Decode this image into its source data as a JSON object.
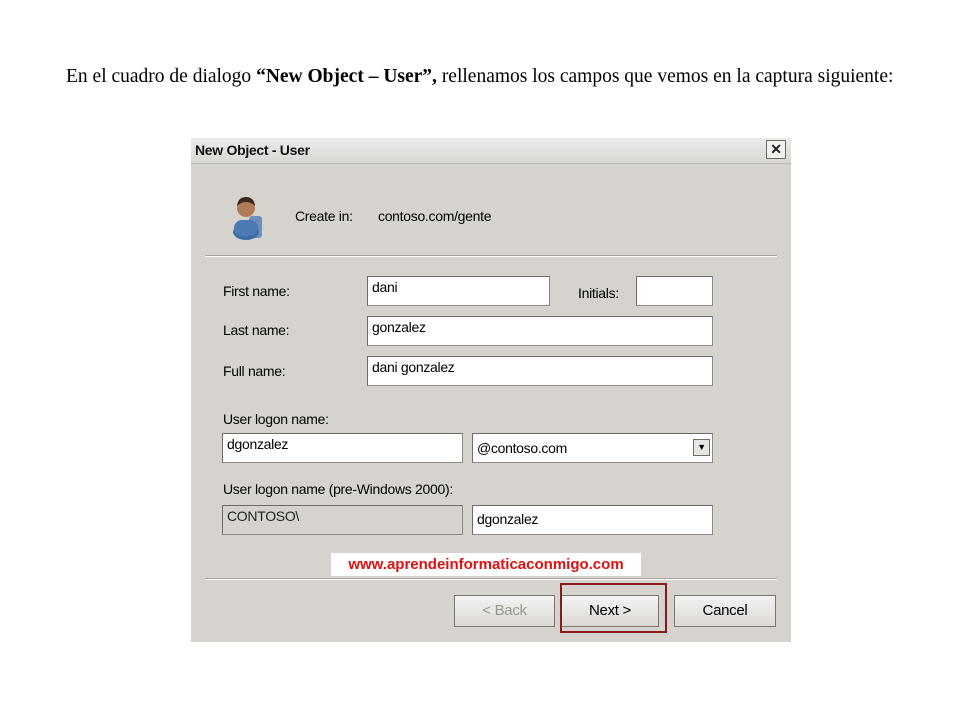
{
  "caption": {
    "before": "En el cuadro de dialogo ",
    "bold": "“New Object – User”,",
    "after": " rellenamos los campos que vemos en la captura siguiente:"
  },
  "dialog": {
    "title": "New Object - User",
    "close_glyph": "✕",
    "create_in_label": "Create in:",
    "create_in_value": "contoso.com/gente",
    "first_name_label": "First name:",
    "first_name_value": "dani",
    "initials_label": "Initials:",
    "initials_value": "",
    "last_name_label": "Last name:",
    "last_name_value": "gonzalez",
    "full_name_label": "Full name:",
    "full_name_value": "dani gonzalez",
    "logon_label": "User logon name:",
    "logon_value": "dgonzalez",
    "domain_value": "@contoso.com",
    "prewin_label": "User logon name (pre-Windows 2000):",
    "prewin_domain": "CONTOSO\\",
    "prewin_value": "dgonzalez",
    "watermark": "www.aprendeinformaticaconmigo.com",
    "back_label": "< Back",
    "next_label": "Next >",
    "cancel_label": "Cancel"
  },
  "icons": {
    "user": "user-icon",
    "dropdown": "chevron-down-icon",
    "close": "close-icon"
  },
  "colors": {
    "highlight": "#8b1a1a",
    "watermark": "#e01010",
    "dialog_bg": "#d6d3ce"
  }
}
